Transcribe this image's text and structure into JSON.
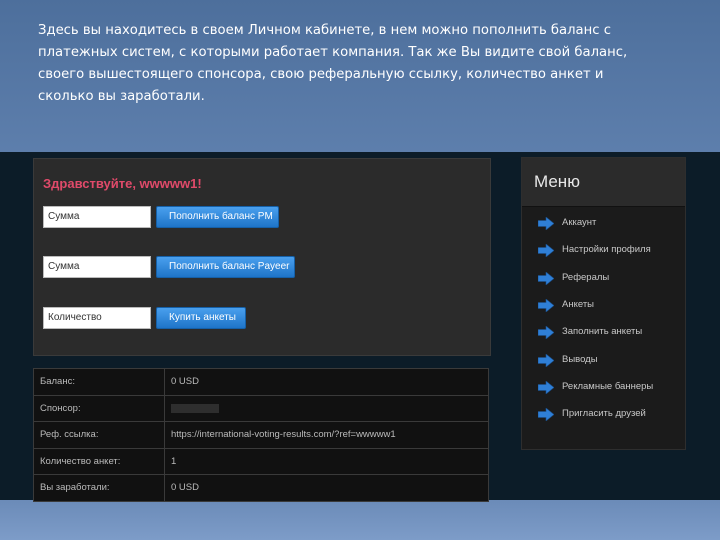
{
  "caption": {
    "lines": [
      "Здесь вы находитесь в своем Личном кабинете, в нем можно пополнить баланс с",
      "платежных систем, с которыми работает компания. Так же Вы видите свой баланс,",
      "своего вышестоящего спонсора, свою реферальную ссылку, количество анкет и",
      "сколько вы заработали."
    ]
  },
  "account": {
    "greeting": "Здравствуйте, wwwww1!",
    "forms": [
      {
        "field_label": "Сумма",
        "button_label": "Пополнить баланс PM"
      },
      {
        "field_label": "Сумма",
        "button_label": "Пополнить баланс Payeer"
      },
      {
        "field_label": "Количество",
        "button_label": "Купить анкеты"
      }
    ]
  },
  "info": {
    "rows": [
      {
        "key": "Баланс:",
        "value": "0 USD"
      },
      {
        "key": "Спонсор:",
        "value": ""
      },
      {
        "key": "Реф. ссылка:",
        "value": "https://international-voting-results.com/?ref=wwwww1"
      },
      {
        "key": "Количество анкет:",
        "value": "1"
      },
      {
        "key": "Вы заработали:",
        "value": "0 USD"
      }
    ]
  },
  "menu": {
    "title": "Меню",
    "items": [
      {
        "label": "Аккаунт",
        "icon": "arrow-right-icon"
      },
      {
        "label": "Настройки профиля",
        "icon": "arrow-right-icon"
      },
      {
        "label": "Рефералы",
        "icon": "arrow-right-icon"
      },
      {
        "label": "Анкеты",
        "icon": "arrow-right-icon"
      },
      {
        "label": "Заполнить анкеты",
        "icon": "arrow-right-icon"
      },
      {
        "label": "Выводы",
        "icon": "arrow-right-icon"
      },
      {
        "label": "Рекламные баннеры",
        "icon": "arrow-right-icon"
      },
      {
        "label": "Пригласить друзей",
        "icon": "arrow-right-icon"
      }
    ]
  },
  "colors": {
    "greeting": "#e04a6a",
    "button": "#2a86d8",
    "arrow": "#2f7fd6",
    "dark_band": "#0c1c28"
  }
}
